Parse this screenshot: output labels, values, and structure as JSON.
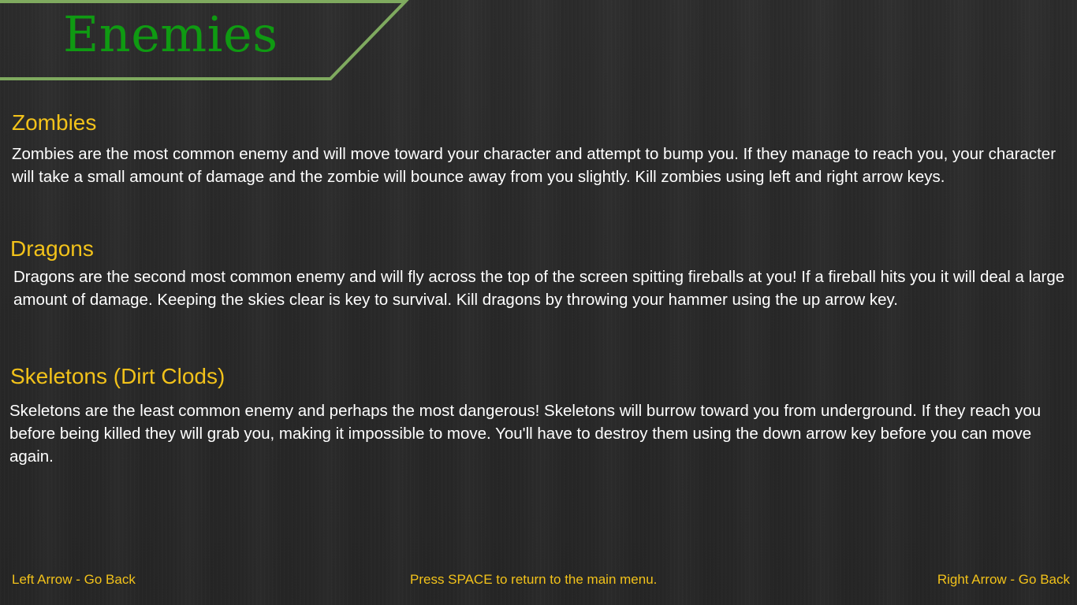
{
  "title": "Enemies",
  "colors": {
    "title": "#0f9a12",
    "banner_border": "#7faa5f",
    "heading": "#f2c21a",
    "body_text": "#ffffff",
    "background": "#2a2a2a"
  },
  "sections": [
    {
      "heading": "Zombies",
      "text": "Zombies are the most common enemy and will move toward your character and attempt to bump you. If they manage to reach you, your character will take a small amount of damage and the zombie will bounce away from you slightly. Kill zombies using left and right arrow keys."
    },
    {
      "heading": "Dragons",
      "text": "Dragons are the second most common enemy and will fly across the top of the screen spitting fireballs at you! If a fireball hits you it will deal a large amount of damage. Keeping the skies clear is key to survival. Kill dragons by throwing your hammer using the up arrow key."
    },
    {
      "heading": "Skeletons (Dirt Clods)",
      "text": "Skeletons are the least common enemy and perhaps the most dangerous! Skeletons will burrow toward you from underground. If they reach you before being killed they will grab you, making it impossible to move. You'll have to destroy them using the down arrow key before you can move again."
    }
  ],
  "footer": {
    "left": "Left Arrow - Go Back",
    "center": "Press SPACE to return to the main menu.",
    "right": "Right Arrow - Go Back"
  }
}
